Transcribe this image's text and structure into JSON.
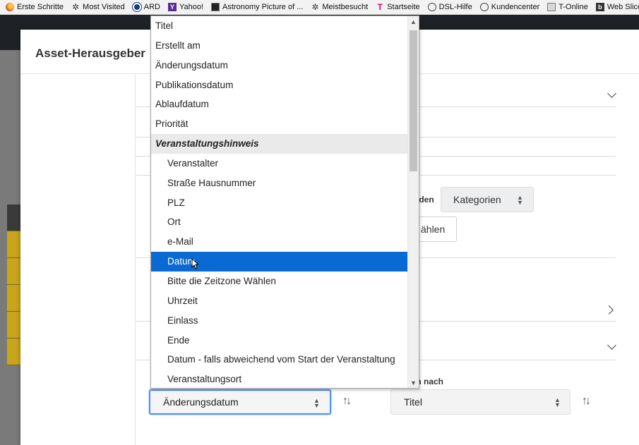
{
  "bookmarks": [
    {
      "label": "Erste Schritte",
      "icon": "firefox-icon"
    },
    {
      "label": "Most Visited",
      "icon": "gear-icon"
    },
    {
      "label": "ARD",
      "icon": "ard-icon"
    },
    {
      "label": "Yahoo!",
      "icon": "yahoo-icon"
    },
    {
      "label": "Astronomy Picture of ...",
      "icon": "apod-icon"
    },
    {
      "label": "Meistbesucht",
      "icon": "gear-icon"
    },
    {
      "label": "Startseite",
      "icon": "telekom-icon"
    },
    {
      "label": "DSL-Hilfe",
      "icon": "globe-icon"
    },
    {
      "label": "Kundencenter",
      "icon": "globe-icon"
    },
    {
      "label": "T-Online",
      "icon": "folder-icon"
    },
    {
      "label": "Web Slice-Ka",
      "icon": "bing-icon"
    }
  ],
  "modal": {
    "title": "Asset-Herausgeber"
  },
  "background_fragments": {
    "group_by_label_fragment": "nden",
    "group_by_value": "Kategorien",
    "select_button_fragment": "ählen",
    "order_by_label_fragment": "nn nach"
  },
  "order_by": {
    "first_value": "Änderungsdatum",
    "second_value": "Titel"
  },
  "dropdown": {
    "options": [
      {
        "label": "Titel",
        "kind": "top"
      },
      {
        "label": "Erstellt am",
        "kind": "top"
      },
      {
        "label": "Änderungsdatum",
        "kind": "top"
      },
      {
        "label": "Publikationsdatum",
        "kind": "top"
      },
      {
        "label": "Ablaufdatum",
        "kind": "top"
      },
      {
        "label": "Priorität",
        "kind": "top"
      },
      {
        "label": "Veranstaltungshinweis",
        "kind": "group"
      },
      {
        "label": "Veranstalter",
        "kind": "child"
      },
      {
        "label": "Straße Hausnummer",
        "kind": "child"
      },
      {
        "label": "PLZ",
        "kind": "child"
      },
      {
        "label": "Ort",
        "kind": "child"
      },
      {
        "label": "e-Mail",
        "kind": "child"
      },
      {
        "label": "Datum",
        "kind": "selected"
      },
      {
        "label": "Bitte die Zeitzone Wählen",
        "kind": "child"
      },
      {
        "label": "Uhrzeit",
        "kind": "child"
      },
      {
        "label": "Einlass",
        "kind": "child"
      },
      {
        "label": "Ende",
        "kind": "child"
      },
      {
        "label": "Datum - falls abweichend vom Start der Veranstaltung",
        "kind": "child"
      },
      {
        "label": "Veranstaltungsort",
        "kind": "child"
      }
    ]
  },
  "colors": {
    "selected_option": "#0a6ad3",
    "focus_ring": "#4d90fe",
    "modal_bg": "#ffffff",
    "dark_header": "#1e2125"
  }
}
